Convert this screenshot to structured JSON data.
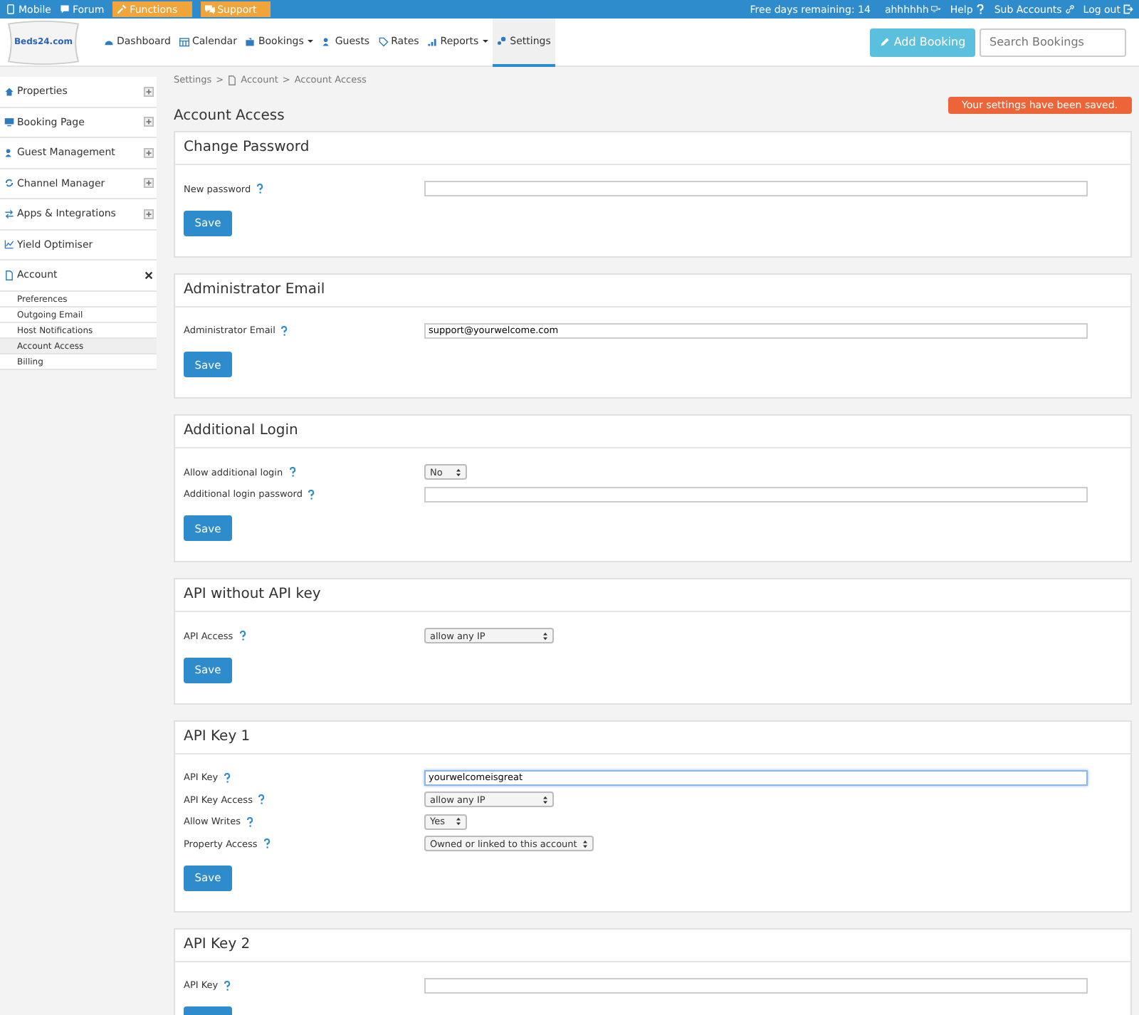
{
  "top_bar": {
    "left": [
      {
        "label": "Mobile",
        "kind": "link"
      },
      {
        "label": "Forum",
        "kind": "link"
      },
      {
        "label": "Functions",
        "kind": "tag"
      },
      {
        "label": "Support",
        "kind": "tag"
      }
    ],
    "right": [
      {
        "label": "Free days remaining: 14",
        "kind": "text"
      },
      {
        "label": "ahhhhhh",
        "kind": "account"
      },
      {
        "label": "Help",
        "kind": "help"
      },
      {
        "label": "Sub Accounts",
        "kind": "subaccounts"
      },
      {
        "label": "Log out",
        "kind": "logout"
      }
    ]
  },
  "logo": {
    "text": "Beds24.com"
  },
  "nav": [
    {
      "label": "Dashboard",
      "dropdown": false,
      "selected": false
    },
    {
      "label": "Calendar",
      "dropdown": false,
      "selected": false
    },
    {
      "label": "Bookings",
      "dropdown": true,
      "selected": false
    },
    {
      "label": "Guests",
      "dropdown": false,
      "selected": false
    },
    {
      "label": "Rates",
      "dropdown": false,
      "selected": false
    },
    {
      "label": "Reports",
      "dropdown": true,
      "selected": false
    },
    {
      "label": "Settings",
      "dropdown": false,
      "selected": true
    }
  ],
  "add_booking": "Add Booking",
  "search": {
    "placeholder": "Search Bookings"
  },
  "sidebar": [
    {
      "label": "Properties",
      "expanded": false
    },
    {
      "label": "Booking Page",
      "expanded": false
    },
    {
      "label": "Guest Management",
      "expanded": false
    },
    {
      "label": "Channel Manager",
      "expanded": false
    },
    {
      "label": "Apps & Integrations",
      "expanded": false
    },
    {
      "label": "Yield Optimiser",
      "kind": "plain"
    },
    {
      "label": "Account",
      "expanded": true,
      "children": [
        {
          "label": "Preferences",
          "selected": false
        },
        {
          "label": "Outgoing Email",
          "selected": false
        },
        {
          "label": "Host Notifications",
          "selected": false
        },
        {
          "label": "Account Access",
          "selected": true
        },
        {
          "label": "Billing",
          "selected": false
        }
      ]
    }
  ],
  "breadcrumb": {
    "separator": ">",
    "items": [
      "Settings",
      "Account",
      "Account Access"
    ]
  },
  "page_title": "Account Access",
  "notice": "Your settings have been saved.",
  "sections": [
    {
      "title": "Change Password",
      "fields": [
        {
          "label": "New password",
          "kind": "text"
        }
      ],
      "save": "Save"
    },
    {
      "title": "Administrator Email",
      "fields": [
        {
          "label": "Administrator Email",
          "kind": "text",
          "value": "support@yourwelcome.com"
        }
      ],
      "save": "Save"
    },
    {
      "title": "Additional Login",
      "fields": [
        {
          "label": "Allow additional login",
          "kind": "select",
          "value": "No"
        },
        {
          "label": "Additional login password",
          "kind": "text"
        }
      ],
      "save": "Save"
    },
    {
      "title": "API without API key",
      "fields": [
        {
          "label": "API Access",
          "kind": "select",
          "value": "allow any IP",
          "wide": true
        }
      ],
      "save": "Save"
    },
    {
      "title": "API Key 1",
      "fields": [
        {
          "label": "API Key",
          "kind": "text",
          "value": "yourwelcomeisgreat",
          "focused": true
        },
        {
          "label": "API Key Access",
          "kind": "select",
          "value": "allow any IP",
          "wide": true
        },
        {
          "label": "Allow Writes",
          "kind": "select",
          "value": "Yes"
        },
        {
          "label": "Property Access",
          "kind": "select",
          "value": "Owned or linked to this account"
        }
      ],
      "save": "Save"
    },
    {
      "title": "API Key 2",
      "fields": [
        {
          "label": "API Key",
          "kind": "text"
        }
      ]
    }
  ]
}
